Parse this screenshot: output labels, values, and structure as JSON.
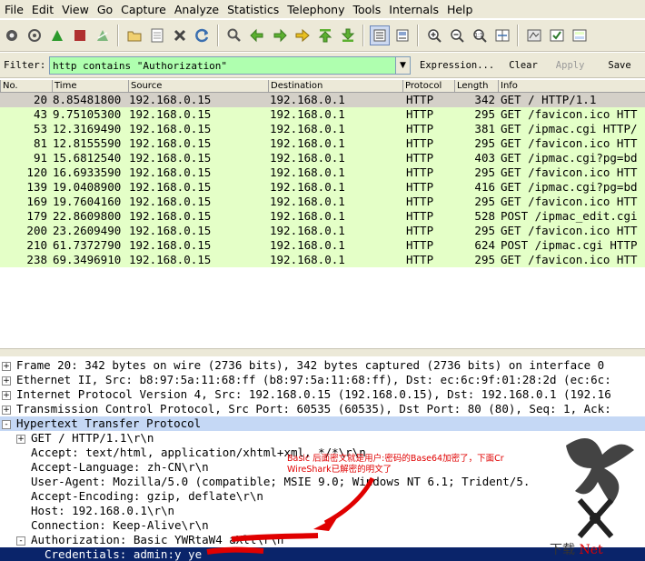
{
  "menu": [
    "File",
    "Edit",
    "View",
    "Go",
    "Capture",
    "Analyze",
    "Statistics",
    "Telephony",
    "Tools",
    "Internals",
    "Help"
  ],
  "toolbar_icons": [
    "interface-list-icon",
    "capture-options-icon",
    "start-capture-icon",
    "stop-capture-icon",
    "restart-capture-icon",
    "open-file-icon",
    "save-file-icon",
    "close-file-icon",
    "reload-icon",
    "find-icon",
    "back-icon",
    "forward-icon",
    "goto-packet-icon",
    "first-packet-icon",
    "last-packet-icon",
    "colorize-icon",
    "autoscroll-icon",
    "zoom-in-icon",
    "zoom-out-icon",
    "normal-size-icon",
    "resize-columns-icon",
    "capture-filters-icon",
    "display-filters-icon",
    "coloring-rules-icon"
  ],
  "filter": {
    "label": "Filter:",
    "value": "http contains \"Authorization\"",
    "expression": "Expression...",
    "clear": "Clear",
    "apply": "Apply",
    "save": "Save",
    "color": "#afffaf"
  },
  "packet_list": {
    "columns": [
      "No.",
      "Time",
      "Source",
      "Destination",
      "Protocol",
      "Length",
      "Info"
    ],
    "rows": [
      {
        "no": "20",
        "time": "8.85481800",
        "src": "192.168.0.15",
        "dst": "192.168.0.1",
        "proto": "HTTP",
        "len": "342",
        "info": "GET / HTTP/1.1"
      },
      {
        "no": "43",
        "time": "9.75105300",
        "src": "192.168.0.15",
        "dst": "192.168.0.1",
        "proto": "HTTP",
        "len": "295",
        "info": "GET /favicon.ico HTT"
      },
      {
        "no": "53",
        "time": "12.3169490",
        "src": "192.168.0.15",
        "dst": "192.168.0.1",
        "proto": "HTTP",
        "len": "381",
        "info": "GET /ipmac.cgi HTTP/"
      },
      {
        "no": "81",
        "time": "12.8155590",
        "src": "192.168.0.15",
        "dst": "192.168.0.1",
        "proto": "HTTP",
        "len": "295",
        "info": "GET /favicon.ico HTT"
      },
      {
        "no": "91",
        "time": "15.6812540",
        "src": "192.168.0.15",
        "dst": "192.168.0.1",
        "proto": "HTTP",
        "len": "403",
        "info": "GET /ipmac.cgi?pg=bd"
      },
      {
        "no": "120",
        "time": "16.6933590",
        "src": "192.168.0.15",
        "dst": "192.168.0.1",
        "proto": "HTTP",
        "len": "295",
        "info": "GET /favicon.ico HTT"
      },
      {
        "no": "139",
        "time": "19.0408900",
        "src": "192.168.0.15",
        "dst": "192.168.0.1",
        "proto": "HTTP",
        "len": "416",
        "info": "GET /ipmac.cgi?pg=bd"
      },
      {
        "no": "169",
        "time": "19.7604160",
        "src": "192.168.0.15",
        "dst": "192.168.0.1",
        "proto": "HTTP",
        "len": "295",
        "info": "GET /favicon.ico HTT"
      },
      {
        "no": "179",
        "time": "22.8609800",
        "src": "192.168.0.15",
        "dst": "192.168.0.1",
        "proto": "HTTP",
        "len": "528",
        "info": "POST /ipmac_edit.cgi"
      },
      {
        "no": "200",
        "time": "23.2609490",
        "src": "192.168.0.15",
        "dst": "192.168.0.1",
        "proto": "HTTP",
        "len": "295",
        "info": "GET /favicon.ico HTT"
      },
      {
        "no": "210",
        "time": "61.7372790",
        "src": "192.168.0.15",
        "dst": "192.168.0.1",
        "proto": "HTTP",
        "len": "624",
        "info": "POST /ipmac.cgi HTTP"
      },
      {
        "no": "238",
        "time": "69.3496910",
        "src": "192.168.0.15",
        "dst": "192.168.0.1",
        "proto": "HTTP",
        "len": "295",
        "info": "GET /favicon.ico HTT"
      }
    ],
    "row_color": "#e4ffc7",
    "selected_color": "#d4d0c8"
  },
  "details": [
    {
      "exp": "+",
      "text": "Frame 20: 342 bytes on wire (2736 bits), 342 bytes captured (2736 bits) on interface 0"
    },
    {
      "exp": "+",
      "text": "Ethernet II, Src: b8:97:5a:11:68:ff (b8:97:5a:11:68:ff), Dst: ec:6c:9f:01:28:2d (ec:6c:"
    },
    {
      "exp": "+",
      "text": "Internet Protocol Version 4, Src: 192.168.0.15 (192.168.0.15), Dst: 192.168.0.1 (192.16"
    },
    {
      "exp": "+",
      "text": "Transmission Control Protocol, Src Port: 60535 (60535), Dst Port: 80 (80), Seq: 1, Ack:"
    },
    {
      "exp": "-",
      "text": "Hypertext Transfer Protocol"
    },
    {
      "exp": "+",
      "text": "GET / HTTP/1.1\\r\\n"
    },
    {
      "exp": "",
      "text": "Accept: text/html, application/xhtml+xml, */*\\r\\n"
    },
    {
      "exp": "",
      "text": "Accept-Language: zh-CN\\r\\n"
    },
    {
      "exp": "",
      "text": "User-Agent: Mozilla/5.0 (compatible; MSIE 9.0; Windows NT 6.1; Trident/5."
    },
    {
      "exp": "",
      "text": "Accept-Encoding: gzip, deflate\\r\\n"
    },
    {
      "exp": "",
      "text": "Host: 192.168.0.1\\r\\n"
    },
    {
      "exp": "",
      "text": "Connection: Keep-Alive\\r\\n"
    },
    {
      "exp": "-",
      "text": "Authorization: Basic YWRtaW4          aXll\\r\\n"
    },
    {
      "exp": "",
      "text": "Credentials: admin:y          ye"
    }
  ],
  "annotation": {
    "line1": "Basic 后面密文就是用户:密码的Base64加密了，下面Cr",
    "line2": "WireShark已解密的明文了",
    "color": "#e00000"
  },
  "watermark": {
    "text_a": "下载",
    "text_b": "Net"
  }
}
